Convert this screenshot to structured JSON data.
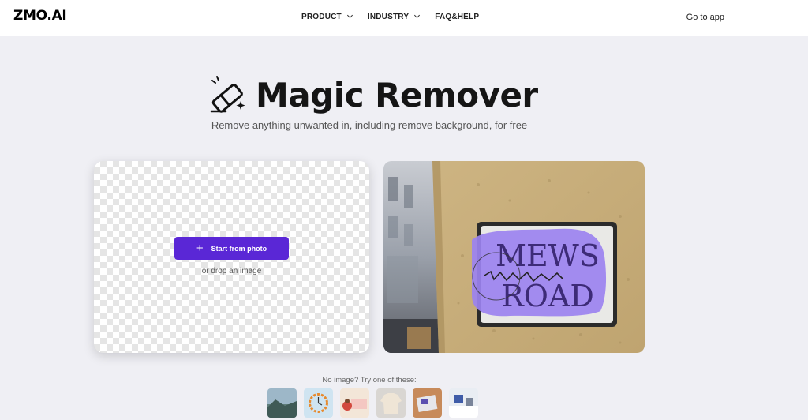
{
  "header": {
    "logo": "ZMO.AI",
    "nav": [
      {
        "label": "PRODUCT",
        "has_dropdown": true
      },
      {
        "label": "INDUSTRY",
        "has_dropdown": true
      },
      {
        "label": "FAQ&HELP",
        "has_dropdown": false
      }
    ],
    "cta": "Go to app"
  },
  "hero": {
    "icon": "eraser-icon",
    "title": "Magic Remover",
    "subtitle": "Remove anything unwanted in, including remove background, for free"
  },
  "upload": {
    "button_label": "Start from photo",
    "button_icon": "plus-icon",
    "drop_text": "or drop an image"
  },
  "demo": {
    "sign_lines": [
      "MEWS",
      "ROAD"
    ]
  },
  "samples": {
    "label": "No image? Try one of these:",
    "items": [
      "sample-landscape",
      "sample-clock",
      "sample-card",
      "sample-sweater",
      "sample-objects",
      "sample-snow"
    ]
  },
  "colors": {
    "accent": "#5a27d6",
    "background": "#efeff4",
    "highlight": "#9b82f0"
  }
}
